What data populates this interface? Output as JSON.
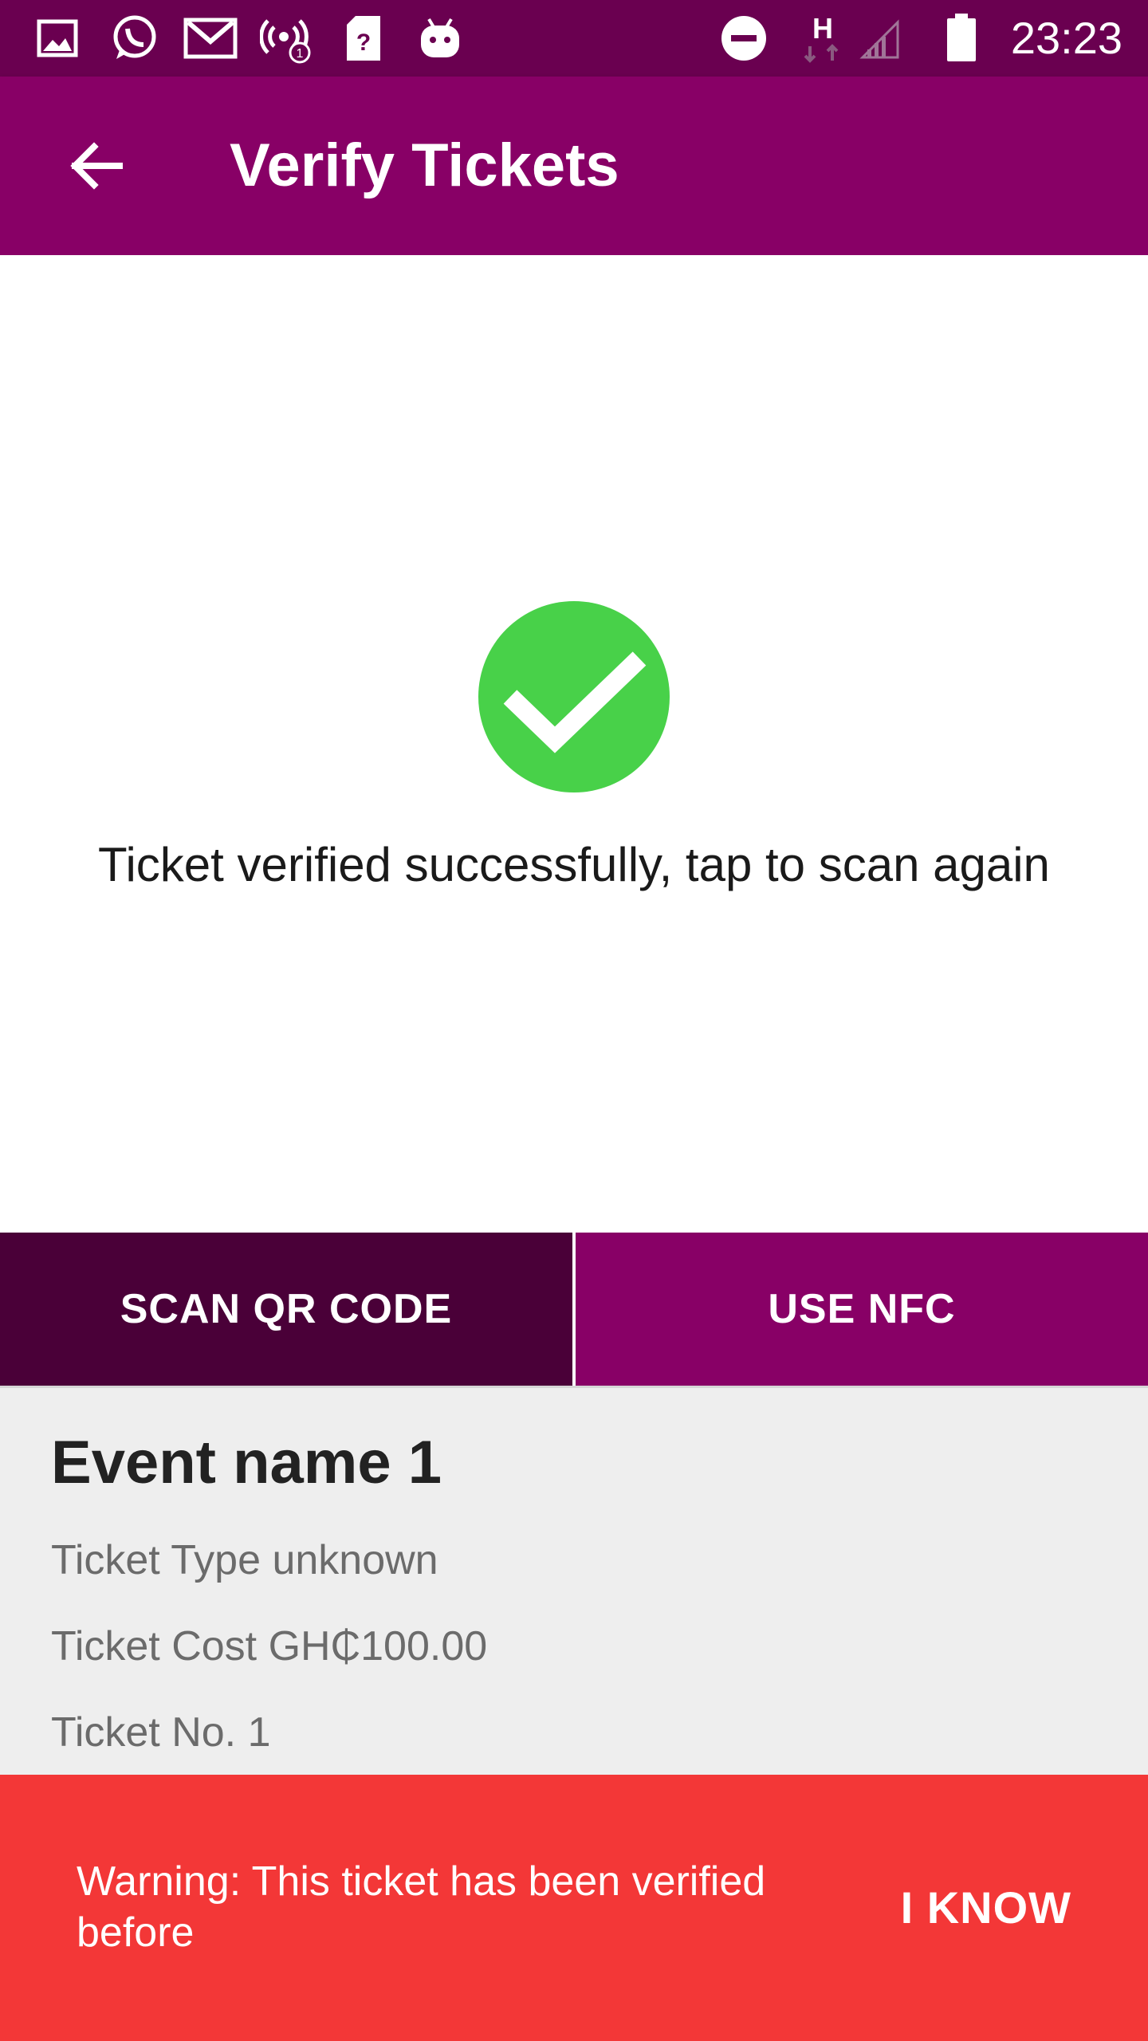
{
  "status_bar": {
    "time": "23:23",
    "network_type": "H",
    "left_icons": [
      "gallery-icon",
      "whatsapp-icon",
      "gmail-icon",
      "hotspot-icon",
      "sim-icon",
      "android-icon"
    ],
    "right_icons": [
      "do-not-disturb-icon",
      "network-h-icon",
      "signal-icon",
      "battery-icon"
    ]
  },
  "app_bar": {
    "title": "Verify Tickets",
    "back_icon": "arrow-left-icon",
    "color": "#880066"
  },
  "result": {
    "icon": "check-circle-icon",
    "message": "Ticket verified successfully, tap to scan again",
    "color": "#48d149"
  },
  "tabs": [
    {
      "label": "SCAN QR CODE",
      "selected": true
    },
    {
      "label": "USE NFC",
      "selected": false
    }
  ],
  "ticket": {
    "event_name": "Event name 1",
    "type_line": "Ticket Type unknown",
    "cost_line": "Ticket Cost GH₵100.00",
    "number_line": "Ticket No. 1"
  },
  "snackbar": {
    "message": "Warning: This ticket has been verified before",
    "action": "I KNOW",
    "color": "#f33737"
  }
}
